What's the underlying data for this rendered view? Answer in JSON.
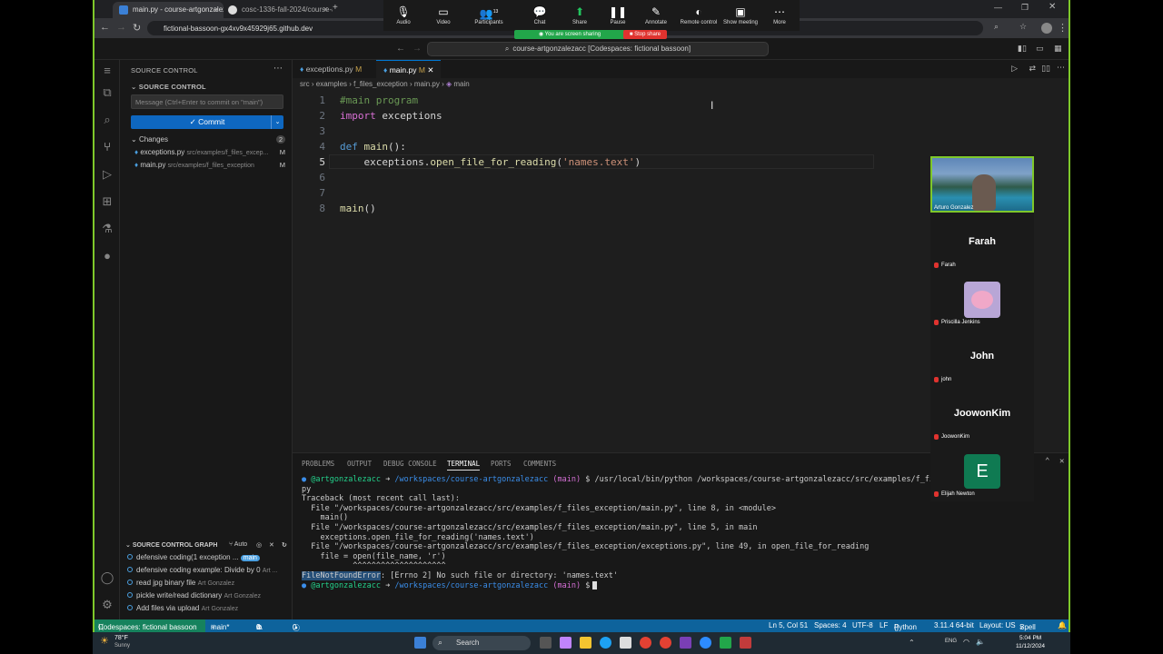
{
  "browser": {
    "tabs": [
      {
        "label": "main.py - course-artgonzalez"
      },
      {
        "label": "cosc-1336-fall-2024/course-a"
      }
    ],
    "url": "fictional-bassoon-gx4xv9x45929j65.github.dev"
  },
  "zoom": {
    "buttons": [
      {
        "label": "Audio",
        "icon": "mic-icon"
      },
      {
        "label": "Video",
        "icon": "camera-icon"
      },
      {
        "label": "Participants",
        "icon": "people-icon",
        "count": "13"
      },
      {
        "label": "Chat",
        "icon": "chat-icon"
      },
      {
        "label": "Share",
        "icon": "share-icon"
      },
      {
        "label": "Pause",
        "icon": "pause-icon"
      },
      {
        "label": "Annotate",
        "icon": "pen-icon"
      },
      {
        "label": "Remote control",
        "icon": "remote-icon"
      },
      {
        "label": "Show meeting",
        "icon": "monitor-icon"
      },
      {
        "label": "More",
        "icon": "more-icon"
      }
    ],
    "sharing_text": "You are screen sharing",
    "stop_share": "Stop share",
    "participants": [
      {
        "name": "Arturo Gonzalez",
        "type": "video"
      },
      {
        "name": "Farah",
        "display": "Farah",
        "type": "name"
      },
      {
        "name": "Priscilla Jenkins",
        "type": "avatar"
      },
      {
        "name": "John",
        "display": "John",
        "small": "john",
        "type": "name"
      },
      {
        "name": "JoowonKim",
        "display": "JoowonKim",
        "type": "name"
      },
      {
        "name": "Elijah Newton",
        "initial": "E",
        "type": "initial"
      }
    ]
  },
  "vscode": {
    "command_center": "course-artgonzalezacc [Codespaces: fictional bassoon]",
    "sidebar": {
      "title": "SOURCE CONTROL",
      "section": "SOURCE CONTROL",
      "message_placeholder": "Message (Ctrl+Enter to commit on \"main\")",
      "commit_label": "✓ Commit",
      "changes_label": "Changes",
      "changes_count": "2",
      "changes": [
        {
          "file": "exceptions.py",
          "path": "src/examples/f_files_excep...",
          "status": "M"
        },
        {
          "file": "main.py",
          "path": "src/examples/f_files_exception",
          "status": "M"
        }
      ],
      "graph_title": "SOURCE CONTROL GRAPH",
      "graph_auto": "Auto",
      "graph": [
        {
          "msg": "defensive coding(1 exception ...",
          "author": "",
          "badge": "main"
        },
        {
          "msg": "defensive coding example: Divide by 0",
          "author": "Art ...",
          "badge": ""
        },
        {
          "msg": "read jpg binary file",
          "author": "Art Gonzalez",
          "badge": ""
        },
        {
          "msg": "pickle write/read dictionary",
          "author": "Art Gonzalez",
          "badge": ""
        },
        {
          "msg": "Add files via upload",
          "author": "Art Gonzalez",
          "badge": ""
        }
      ]
    },
    "tabs": [
      {
        "label": "exceptions.py",
        "mod": "M"
      },
      {
        "label": "main.py",
        "mod": "M"
      }
    ],
    "breadcrumb": [
      "src",
      "examples",
      "f_files_exception",
      "main.py",
      "main"
    ],
    "code": [
      {
        "n": "1",
        "parts": [
          {
            "t": "#main program",
            "c": "cm"
          }
        ]
      },
      {
        "n": "2",
        "parts": [
          {
            "t": "import",
            "c": "pn"
          },
          {
            "t": " exceptions",
            "c": ""
          }
        ]
      },
      {
        "n": "3",
        "parts": []
      },
      {
        "n": "4",
        "parts": [
          {
            "t": "def",
            "c": "kw"
          },
          {
            "t": " ",
            "c": ""
          },
          {
            "t": "main",
            "c": "fn"
          },
          {
            "t": "():",
            "c": ""
          }
        ]
      },
      {
        "n": "5",
        "parts": [
          {
            "t": "    exceptions.",
            "c": ""
          },
          {
            "t": "open_file_for_reading",
            "c": "fn"
          },
          {
            "t": "(",
            "c": ""
          },
          {
            "t": "'names.text'",
            "c": "str"
          },
          {
            "t": ")",
            "c": ""
          }
        ]
      },
      {
        "n": "6",
        "parts": []
      },
      {
        "n": "7",
        "parts": []
      },
      {
        "n": "8",
        "parts": [
          {
            "t": "main",
            "c": "fn"
          },
          {
            "t": "()",
            "c": ""
          }
        ]
      }
    ],
    "panel_tabs": [
      "PROBLEMS",
      "OUTPUT",
      "DEBUG CONSOLE",
      "TERMINAL",
      "PORTS",
      "COMMENTS"
    ],
    "terminal": {
      "prompt_user": "@artgonzalezacc",
      "prompt_path": "/workspaces/course-artgonzalezacc",
      "prompt_branch": "(main)",
      "command": "$ /usr/local/bin/python /workspaces/course-artgonzalezacc/src/examples/f_files_",
      "lines": [
        "py",
        "Traceback (most recent call last):",
        "  File \"/workspaces/course-artgonzalezacc/src/examples/f_files_exception/main.py\", line 8, in <module>",
        "    main()",
        "  File \"/workspaces/course-artgonzalezacc/src/examples/f_files_exception/main.py\", line 5, in main",
        "    exceptions.open_file_for_reading('names.text')",
        "  File \"/workspaces/course-artgonzalezacc/src/examples/f_files_exception/exceptions.py\", line 49, in open_file_for_reading",
        "    file = open(file_name, 'r')",
        "           ^^^^^^^^^^^^^^^^^^^^"
      ],
      "error_name": "FileNotFoundError",
      "error_msg": ": [Errno 2] No such file or directory: 'names.text'",
      "final_prompt_end": "$"
    },
    "status": {
      "remote": "Codespaces: fictional bassoon",
      "branch": "main*",
      "errors": "0",
      "warnings": "0",
      "ports": "0",
      "position": "Ln 5, Col 51",
      "spaces": "Spaces: 4",
      "encoding": "UTF-8",
      "eol": "LF",
      "language": "Python",
      "interpreter": "3.11.4 64-bit",
      "layout": "Layout: US",
      "spell": "Spell"
    }
  },
  "taskbar": {
    "weather_temp": "78°F",
    "weather_desc": "Sunny",
    "search": "Search",
    "lang": "ENG",
    "time": "5:04 PM",
    "date": "11/12/2024"
  }
}
